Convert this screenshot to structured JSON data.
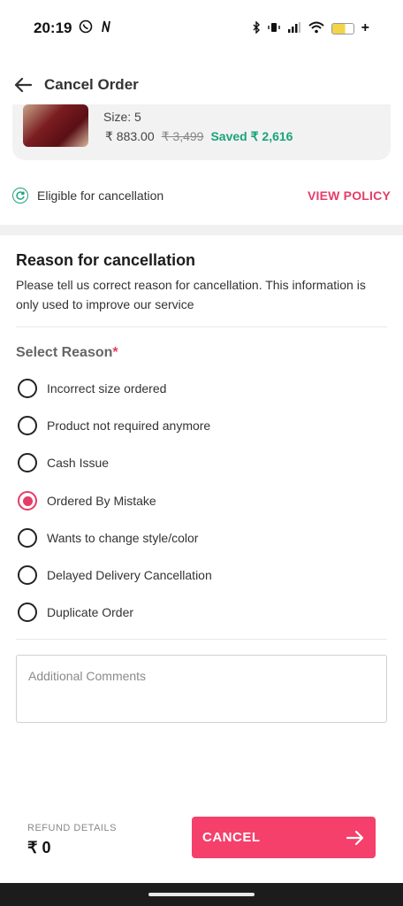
{
  "status_bar": {
    "time": "20:19"
  },
  "header": {
    "title": "Cancel Order"
  },
  "product": {
    "size": "Size: 5",
    "price": "₹ 883.00",
    "mrp": "₹ 3,499",
    "saved": "Saved ₹ 2,616"
  },
  "eligibility": {
    "text": "Eligible for cancellation",
    "policy_link": "VIEW POLICY"
  },
  "reason": {
    "title": "Reason for cancellation",
    "description": "Please tell us correct reason for cancellation. This information is only used to improve our service",
    "select_label": "Select Reason",
    "required_mark": "*",
    "options": [
      {
        "label": "Incorrect size ordered",
        "selected": false
      },
      {
        "label": "Product not required anymore",
        "selected": false
      },
      {
        "label": "Cash Issue",
        "selected": false
      },
      {
        "label": "Ordered By Mistake",
        "selected": true
      },
      {
        "label": "Wants to change style/color",
        "selected": false
      },
      {
        "label": "Delayed Delivery Cancellation",
        "selected": false
      },
      {
        "label": "Duplicate Order",
        "selected": false
      }
    ],
    "comments_placeholder": "Additional Comments"
  },
  "footer": {
    "refund_label": "REFUND DETAILS",
    "refund_value": "₹ 0",
    "cancel_label": "CANCEL"
  },
  "colors": {
    "accent": "#f4406b",
    "success": "#1aa37a"
  }
}
